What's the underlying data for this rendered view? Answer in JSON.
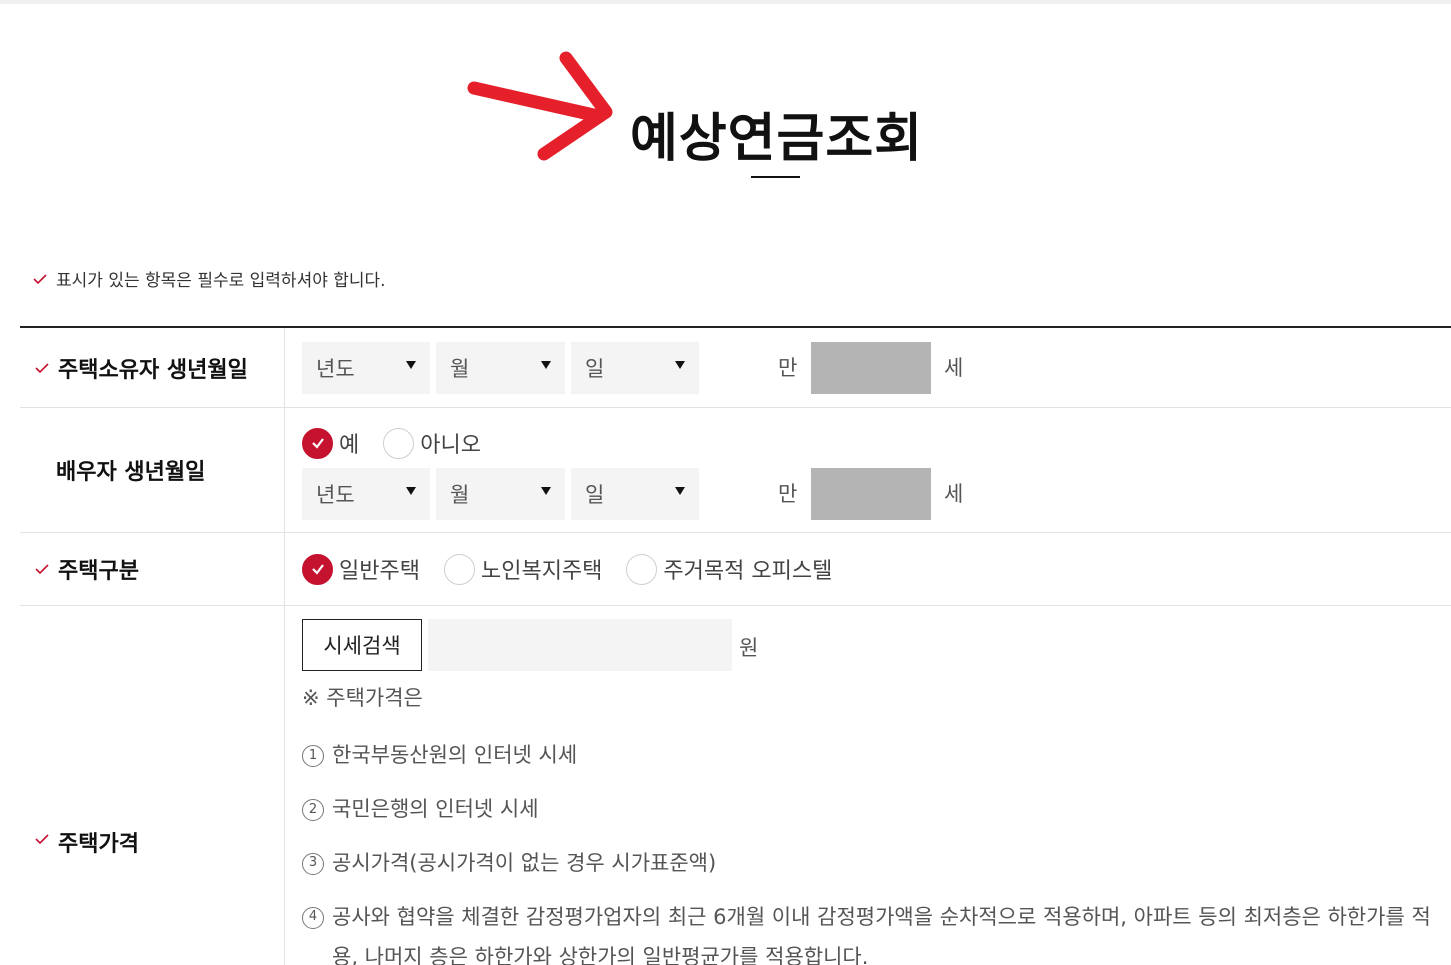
{
  "page": {
    "title": "예상연금조회",
    "required_note": "표시가 있는 항목은 필수로 입력하셔야 합니다."
  },
  "colors": {
    "accent": "#c4122f",
    "check_mark": "#c4122f"
  },
  "rows": {
    "owner_birth": {
      "label": "주택소유자 생년월일",
      "year": "년도",
      "month": "월",
      "day": "일",
      "age_prefix": "만",
      "age_suffix": "세"
    },
    "spouse_birth": {
      "label": "배우자 생년월일",
      "yes": "예",
      "no": "아니오",
      "selected": "예",
      "year": "년도",
      "month": "월",
      "day": "일",
      "age_prefix": "만",
      "age_suffix": "세"
    },
    "house_type": {
      "label": "주택구분",
      "options": [
        "일반주택",
        "노인복지주택",
        "주거목적 오피스텔"
      ],
      "selected": "일반주택"
    },
    "house_price": {
      "label": "주택가격",
      "search_button": "시세검색",
      "unit": "원",
      "note": "※ 주택가격은",
      "items": [
        {
          "num": "1",
          "text": "한국부동산원의 인터넷 시세"
        },
        {
          "num": "2",
          "text": "국민은행의 인터넷 시세"
        },
        {
          "num": "3",
          "text": "공시가격(공시가격이 없는 경우 시가표준액)"
        },
        {
          "num": "4",
          "text": "공사와 협약을 체결한 감정평가업자의 최근 6개월 이내 감정평가액을 순차적으로 적용하며, 아파트 등의 최저층은 하한가를 적용, 나머지 층은 하한가와 상한가의 일반평균가를 적용합니다."
        }
      ]
    }
  },
  "icons": {
    "title_arrow": "red-arrow-icon",
    "required": "check-icon",
    "caret": "caret-down-icon"
  }
}
